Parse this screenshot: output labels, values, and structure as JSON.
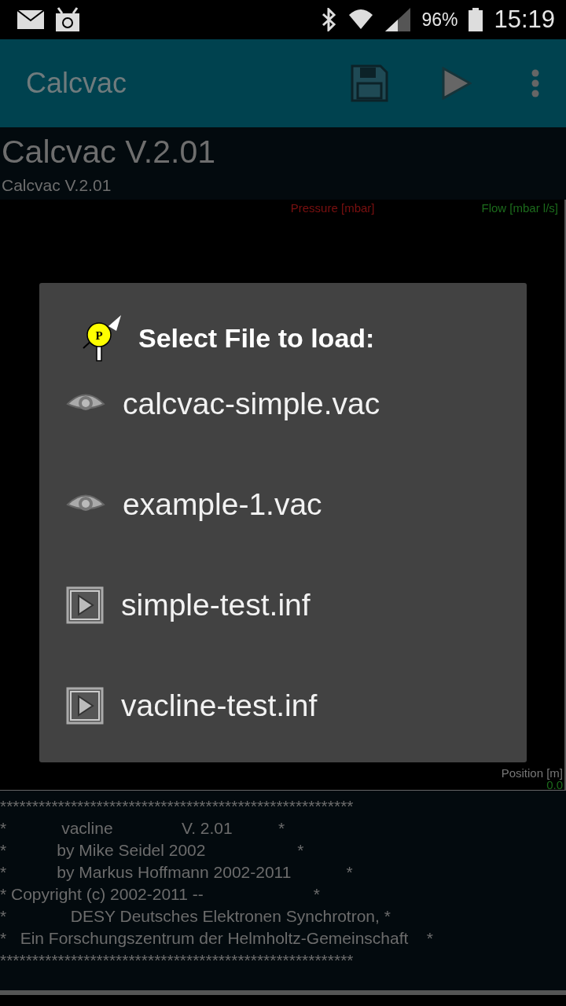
{
  "status_bar": {
    "battery": "96%",
    "time": "15:19"
  },
  "app_bar": {
    "title": "Calcvac"
  },
  "header": {
    "title": "Calcvac V.2.01",
    "subtitle": "Calcvac V.2.01"
  },
  "plot": {
    "left_label": "Pressure [mbar]",
    "right_label": "Flow [mbar l/s]",
    "x_label": "Position [m]",
    "x_tick": "0.0"
  },
  "dialog": {
    "icon_letter": "P",
    "title": "Select File to load:",
    "files": [
      {
        "name": "calcvac-simple.vac",
        "kind": "eye"
      },
      {
        "name": "example-1.vac",
        "kind": "eye"
      },
      {
        "name": "simple-test.inf",
        "kind": "play"
      },
      {
        "name": "vacline-test.inf",
        "kind": "play"
      }
    ]
  },
  "console": {
    "lines": [
      "*******************************************************",
      "*            vacline               V. 2.01          *",
      "*           by Mike Seidel 2002                    *",
      "*           by Markus Hoffmann 2002-2011            *",
      "* Copyright (c) 2002-2011 --                        *",
      "*              DESY Deutsches Elektronen Synchrotron, *",
      "*   Ein Forschungszentrum der Helmholtz-Gemeinschaft    *",
      "*******************************************************"
    ]
  }
}
